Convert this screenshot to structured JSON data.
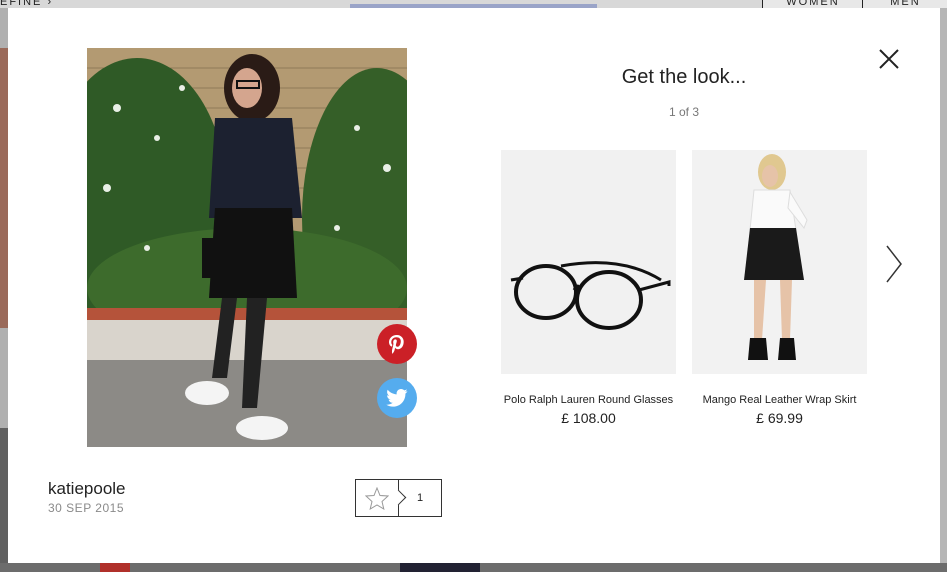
{
  "background_page": {
    "refine_label": "EFINE",
    "nav_women": "WOMEN",
    "nav_men": "MEN"
  },
  "modal": {
    "title": "Get the look...",
    "pager": "1 of 3",
    "author": {
      "username": "katiepoole",
      "date": "30 SEP 2015"
    },
    "likes": {
      "count": "1"
    },
    "share": {
      "pinterest_icon": "pinterest-icon",
      "twitter_icon": "twitter-icon"
    },
    "products": [
      {
        "name": "Polo Ralph Lauren Round Glasses",
        "price": "£ 108.00"
      },
      {
        "name": "Mango Real Leather Wrap Skirt",
        "price": "£ 69.99"
      }
    ],
    "icons": {
      "close": "close-icon",
      "next": "chevron-right-icon",
      "like": "star-icon"
    },
    "colors": {
      "pinterest": "#cb2027",
      "twitter": "#55acee"
    }
  }
}
